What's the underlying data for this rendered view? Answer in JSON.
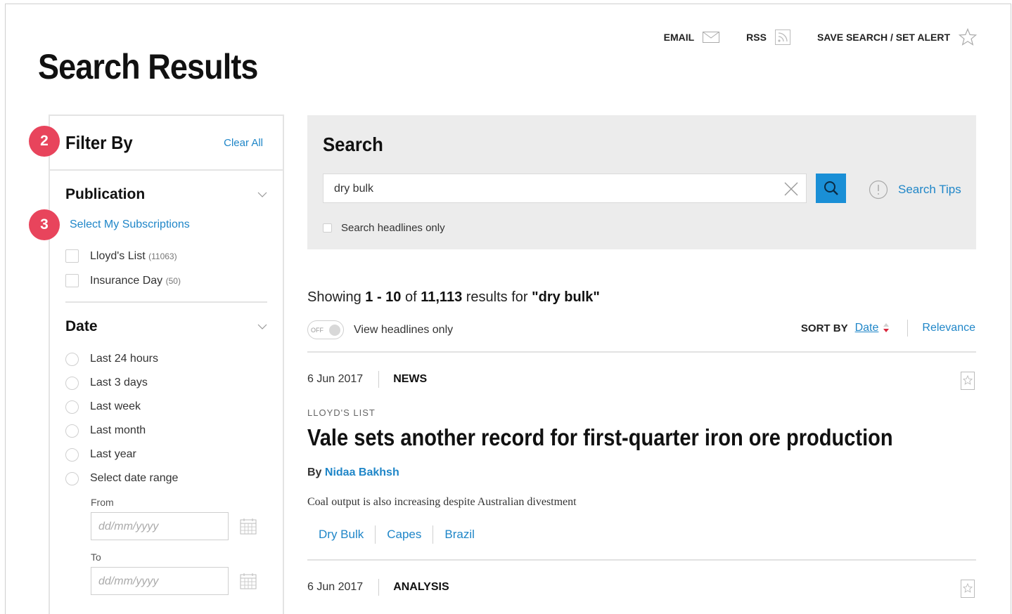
{
  "page_title": "Search Results",
  "top_actions": {
    "email": "EMAIL",
    "rss": "RSS",
    "save_search": "SAVE SEARCH / SET ALERT"
  },
  "badges": {
    "filter": "2",
    "subscriptions": "3"
  },
  "filter": {
    "title": "Filter By",
    "clear_all": "Clear All",
    "publication": {
      "title": "Publication",
      "select_subscriptions": "Select My Subscriptions",
      "items": [
        {
          "label": "Lloyd's List",
          "count": "(11063)"
        },
        {
          "label": "Insurance Day",
          "count": "(50)"
        }
      ]
    },
    "date": {
      "title": "Date",
      "options": [
        "Last 24 hours",
        "Last 3 days",
        "Last week",
        "Last month",
        "Last year",
        "Select date range"
      ],
      "from_label": "From",
      "to_label": "To",
      "placeholder": "dd/mm/yyyy"
    }
  },
  "search": {
    "title": "Search",
    "query": "dry bulk",
    "tips": "Search Tips",
    "headlines_only": "Search headlines only"
  },
  "results": {
    "showing_prefix": "Showing ",
    "range": "1 - 10",
    "of": " of ",
    "total": "11,113",
    "results_for": " results for ",
    "query_quoted": "\"dry bulk\"",
    "toggle_state": "OFF",
    "view_headlines": "View headlines only",
    "sort_by": "SORT BY",
    "sort_date": "Date",
    "sort_relevance": "Relevance",
    "items": [
      {
        "date": "6 Jun 2017",
        "type": "NEWS",
        "source": "LLOYD'S LIST",
        "headline": "Vale sets another record for first-quarter iron ore production",
        "by": "By ",
        "author": "Nidaa Bakhsh",
        "summary": "Coal output is also increasing despite Australian divestment",
        "tags": [
          "Dry Bulk",
          "Capes",
          "Brazil"
        ]
      },
      {
        "date": "6 Jun 2017",
        "type": "ANALYSIS"
      }
    ]
  },
  "colors": {
    "accent": "#1f86c8",
    "search_button": "#1a8fd6",
    "badge": "#e8445c",
    "sort_arrow": "#d9273c"
  }
}
